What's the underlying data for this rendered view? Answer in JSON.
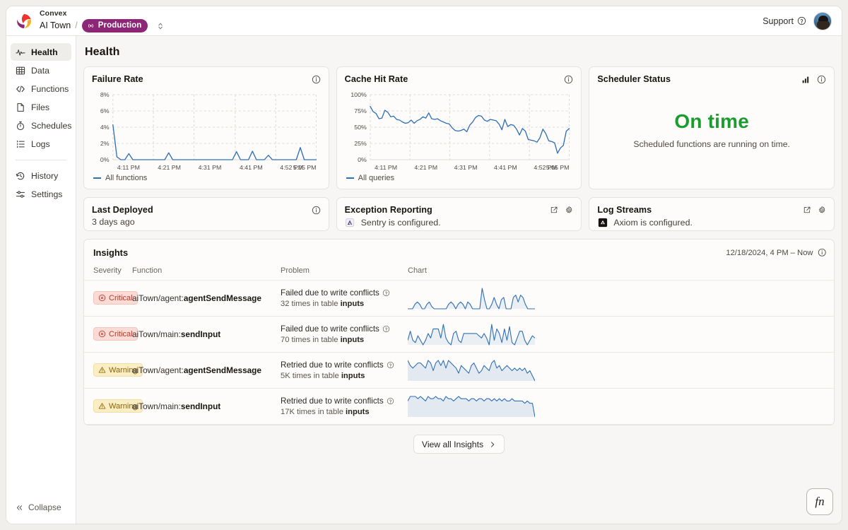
{
  "topbar": {
    "brand": "Convex",
    "project": "AI Town",
    "separator": "/",
    "deployment_pill": "Production",
    "deployment_icon": "broadcast-icon",
    "selector_icon": "chevron-up-down-icon",
    "support_label": "Support",
    "support_icon": "question-circle-icon",
    "avatar_name": "user-avatar"
  },
  "sidebar": {
    "items": [
      {
        "label": "Health",
        "icon": "activity-icon",
        "active": true
      },
      {
        "label": "Data",
        "icon": "table-icon",
        "active": false
      },
      {
        "label": "Functions",
        "icon": "code-icon",
        "active": false
      },
      {
        "label": "Files",
        "icon": "file-icon",
        "active": false
      },
      {
        "label": "Schedules",
        "icon": "timer-icon",
        "active": false
      },
      {
        "label": "Logs",
        "icon": "list-icon",
        "active": false
      }
    ],
    "items_secondary": [
      {
        "label": "History",
        "icon": "history-icon"
      },
      {
        "label": "Settings",
        "icon": "sliders-icon"
      }
    ],
    "collapse_label": "Collapse",
    "collapse_icon": "chevrons-left-icon"
  },
  "page": {
    "title": "Health"
  },
  "cards": {
    "failure_rate": {
      "title": "Failure Rate",
      "info_icon": "info-icon",
      "legend": "All functions"
    },
    "cache_hit_rate": {
      "title": "Cache Hit Rate",
      "info_icon": "info-icon",
      "legend": "All queries"
    },
    "scheduler_status": {
      "title": "Scheduler Status",
      "chart_icon": "bar-chart-icon",
      "info_icon": "info-icon",
      "status": "On time",
      "status_color": "#1a9c2e",
      "description": "Scheduled functions are running on time."
    },
    "last_deployed": {
      "title": "Last Deployed",
      "info_icon": "info-icon",
      "value": "3 days ago"
    },
    "exception_reporting": {
      "title": "Exception Reporting",
      "external_icon": "external-link-icon",
      "gear_icon": "gear-icon",
      "service_icon": "sentry-icon",
      "value": "Sentry is configured."
    },
    "log_streams": {
      "title": "Log Streams",
      "external_icon": "external-link-icon",
      "gear_icon": "gear-icon",
      "service_icon": "axiom-icon",
      "value": "Axiom is configured."
    }
  },
  "insights": {
    "title": "Insights",
    "range": "12/18/2024, 4 PM – Now",
    "info_icon": "info-icon",
    "columns": [
      "Severity",
      "Function",
      "Problem",
      "Chart"
    ],
    "rows": [
      {
        "severity": "Critical",
        "severity_icon": "error-circle-icon",
        "function_prefix": "aiTown/agent:",
        "function_name": "agentSendMessage",
        "problem": "Failed due to write conflicts",
        "problem_help_icon": "question-circle-icon",
        "count_prefix": "32 times in table ",
        "table_name": "inputs"
      },
      {
        "severity": "Critical",
        "severity_icon": "error-circle-icon",
        "function_prefix": "aiTown/main:",
        "function_name": "sendInput",
        "problem": "Failed due to write conflicts",
        "problem_help_icon": "question-circle-icon",
        "count_prefix": "70 times in table ",
        "table_name": "inputs"
      },
      {
        "severity": "Warning",
        "severity_icon": "warning-triangle-icon",
        "function_prefix": "aiTown/agent:",
        "function_name": "agentSendMessage",
        "problem": "Retried due to write conflicts",
        "problem_help_icon": "question-circle-icon",
        "count_prefix": "5K times in table ",
        "table_name": "inputs"
      },
      {
        "severity": "Warning",
        "severity_icon": "warning-triangle-icon",
        "function_prefix": "aiTown/main:",
        "function_name": "sendInput",
        "problem": "Retried due to write conflicts",
        "problem_help_icon": "question-circle-icon",
        "count_prefix": "17K times in table ",
        "table_name": "inputs"
      }
    ],
    "view_all_label": "View all Insights",
    "view_all_icon": "chevron-right-icon"
  },
  "fab": {
    "label": "fn",
    "name": "functions-fab"
  },
  "colors": {
    "line": "#2f6fb5",
    "accent_purple": "#8d2676",
    "critical_bg": "#fbdbd6",
    "critical_fg": "#b4392a",
    "warning_bg": "#fbeec4",
    "warning_fg": "#8a6408",
    "status_green": "#1a9c2e"
  },
  "chart_data": [
    {
      "type": "line",
      "name": "failure_rate",
      "title": "Failure Rate",
      "xlabel": "",
      "ylabel": "",
      "ylim": [
        0,
        8
      ],
      "ytick_labels": [
        "0%",
        "2%",
        "4%",
        "6%",
        "8%"
      ],
      "yticks": [
        0,
        2,
        4,
        6,
        8
      ],
      "xtick_labels": [
        "4:11 PM",
        "4:21 PM",
        "4:31 PM",
        "4:41 PM",
        "4:52 PM",
        "5:05 PM"
      ],
      "grid": true,
      "legend": [
        "All functions"
      ],
      "legend_position": "below",
      "series": [
        {
          "name": "All functions",
          "color": "#2f6fb5",
          "values": [
            4.3,
            0.35,
            0.0,
            0.0,
            0.75,
            0.0,
            0.0,
            0.0,
            0.0,
            0.0,
            0.0,
            0.0,
            0.0,
            0.0,
            0.85,
            0.0,
            0.0,
            0.0,
            0.0,
            0.0,
            0.0,
            0.0,
            0.0,
            0.0,
            0.0,
            0.0,
            0.0,
            0.0,
            0.0,
            0.0,
            0.0,
            1.0,
            0.0,
            0.0,
            0.0,
            1.05,
            0.0,
            0.0,
            0.0,
            0.55,
            0.0,
            0.0,
            0.0,
            0.0,
            0.0,
            0.0,
            0.0,
            1.5,
            0.0,
            0.0,
            0.0,
            0.0
          ]
        }
      ]
    },
    {
      "type": "line",
      "name": "cache_hit_rate",
      "title": "Cache Hit Rate",
      "xlabel": "",
      "ylabel": "",
      "ylim": [
        0,
        100
      ],
      "ytick_labels": [
        "0%",
        "25%",
        "50%",
        "75%",
        "100%"
      ],
      "yticks": [
        0,
        25,
        50,
        75,
        100
      ],
      "xtick_labels": [
        "4:11 PM",
        "4:21 PM",
        "4:31 PM",
        "4:41 PM",
        "4:52 PM",
        "5:05 PM"
      ],
      "grid": true,
      "legend": [
        "All queries"
      ],
      "legend_position": "below",
      "series": [
        {
          "name": "All queries",
          "color": "#2f6fb5",
          "values": [
            82,
            74,
            71,
            63,
            64,
            76,
            73,
            66,
            67,
            62,
            61,
            58,
            56,
            57,
            61,
            56,
            60,
            62,
            66,
            64,
            72,
            63,
            62,
            63,
            60,
            58,
            56,
            55,
            49,
            45,
            44,
            45,
            47,
            43,
            53,
            58,
            65,
            68,
            67,
            61,
            59,
            62,
            61,
            60,
            55,
            46,
            62,
            51,
            54,
            53,
            47,
            38,
            48,
            44,
            31,
            30,
            29,
            27,
            34,
            47,
            40,
            29,
            28,
            26,
            10,
            18,
            22,
            44,
            48
          ]
        }
      ]
    },
    {
      "type": "line",
      "name": "insight-sparkline-1",
      "title": "aiTown/agent:agentSendMessage — Failed due to write conflicts",
      "grid": false,
      "series": [
        {
          "name": "occurrences",
          "color": "#2f6fb5",
          "values": [
            0,
            0,
            0,
            2,
            3,
            2,
            0,
            0,
            2,
            3,
            1,
            0,
            0,
            0,
            0,
            0,
            0,
            2,
            3,
            2,
            0,
            2,
            3,
            2,
            0,
            3,
            2,
            0,
            0,
            0,
            0,
            9,
            4,
            0,
            0,
            2,
            5,
            2,
            0,
            4,
            5,
            0,
            0,
            0,
            5,
            6,
            3,
            6,
            5,
            2,
            0,
            0,
            0,
            0
          ]
        }
      ]
    },
    {
      "type": "line",
      "name": "insight-sparkline-2",
      "title": "aiTown/main:sendInput — Failed due to write conflicts",
      "grid": false,
      "series": [
        {
          "name": "occurrences",
          "color": "#2f6fb5",
          "values": [
            2,
            6,
            2,
            1,
            4,
            2,
            0,
            2,
            5,
            3,
            7,
            7,
            7,
            3,
            9,
            3,
            1,
            0,
            5,
            6,
            2,
            1,
            5,
            5,
            5,
            5,
            5,
            5,
            4,
            3,
            5,
            3,
            0,
            9,
            2,
            7,
            5,
            1,
            7,
            2,
            8,
            1,
            0,
            3,
            6,
            6,
            2,
            0,
            2,
            4,
            3
          ]
        }
      ]
    },
    {
      "type": "line",
      "name": "insight-sparkline-3",
      "title": "aiTown/agent:agentSendMessage — Retried due to write conflicts",
      "grid": false,
      "series": [
        {
          "name": "occurrences",
          "color": "#2f6fb5",
          "values": [
            8,
            6,
            5,
            6,
            7,
            7,
            6,
            5,
            8,
            7,
            4,
            7,
            8,
            6,
            8,
            5,
            8,
            7,
            6,
            5,
            3,
            6,
            5,
            4,
            3,
            6,
            7,
            5,
            3,
            4,
            6,
            5,
            4,
            7,
            8,
            5,
            6,
            4,
            5,
            6,
            5,
            4,
            5,
            4,
            5,
            4,
            5,
            3,
            4,
            2,
            0
          ]
        }
      ]
    },
    {
      "type": "line",
      "name": "insight-sparkline-4",
      "title": "aiTown/main:sendInput — Retried due to write conflicts",
      "grid": false,
      "series": [
        {
          "name": "occurrences",
          "color": "#2f6fb5",
          "values": [
            7,
            9,
            9,
            9,
            8,
            9,
            8,
            7,
            9,
            8,
            8,
            9,
            8,
            8,
            7,
            9,
            8,
            8,
            7,
            8,
            9,
            8,
            8,
            8,
            7,
            8,
            8,
            7,
            8,
            8,
            7,
            8,
            8,
            7,
            8,
            7,
            8,
            7,
            8,
            7,
            7,
            8,
            7,
            7,
            7,
            7,
            6,
            7,
            6,
            6,
            0
          ]
        }
      ]
    }
  ]
}
